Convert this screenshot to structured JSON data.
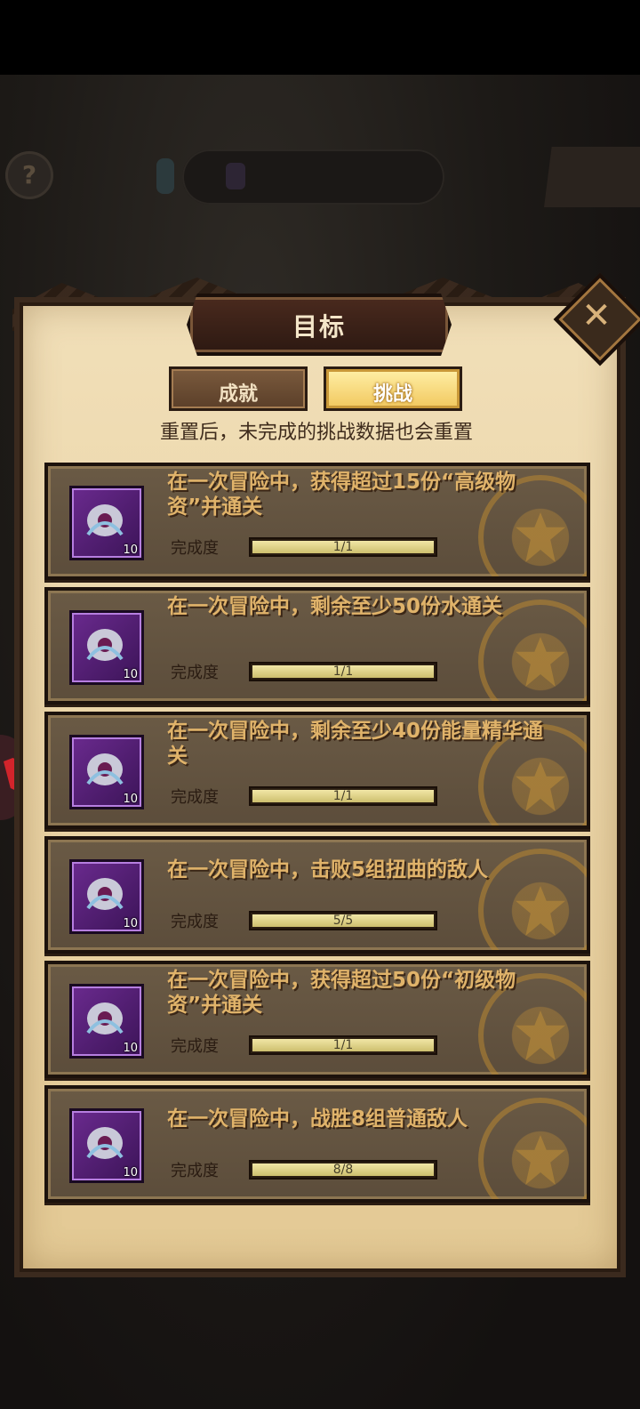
{
  "background": {
    "help_symbol": "?",
    "resource_text": "",
    "right_button_label": ""
  },
  "dialog": {
    "title": "目标",
    "close_symbol": "✕",
    "tabs": [
      {
        "label": "成就",
        "selected": false
      },
      {
        "label": "挑战",
        "selected": true
      }
    ],
    "notice": "重置后，未完成的挑战数据也会重置",
    "progress_label": "完成度",
    "challenges": [
      {
        "title": "在一次冒险中，获得超过15份“高级物资”并通关",
        "reward_count": "10",
        "progress_text": "1/1",
        "progress": 1.0
      },
      {
        "title": "在一次冒险中，剩余至少50份水通关",
        "reward_count": "10",
        "progress_text": "1/1",
        "progress": 1.0
      },
      {
        "title": "在一次冒险中，剩余至少40份能量精华通关",
        "reward_count": "10",
        "progress_text": "1/1",
        "progress": 1.0
      },
      {
        "title": "在一次冒险中，击败5组扭曲的敌人",
        "reward_count": "10",
        "progress_text": "5/5",
        "progress": 1.0
      },
      {
        "title": "在一次冒险中，获得超过50份“初级物资”并通关",
        "reward_count": "10",
        "progress_text": "1/1",
        "progress": 1.0
      },
      {
        "title": "在一次冒险中，战胜8组普通敌人",
        "reward_count": "10",
        "progress_text": "8/8",
        "progress": 1.0
      }
    ]
  },
  "colors": {
    "title_gold": "#e0b36a",
    "reward_purple": "#6a2a8e",
    "progress_fill": "#f1e6a6"
  }
}
